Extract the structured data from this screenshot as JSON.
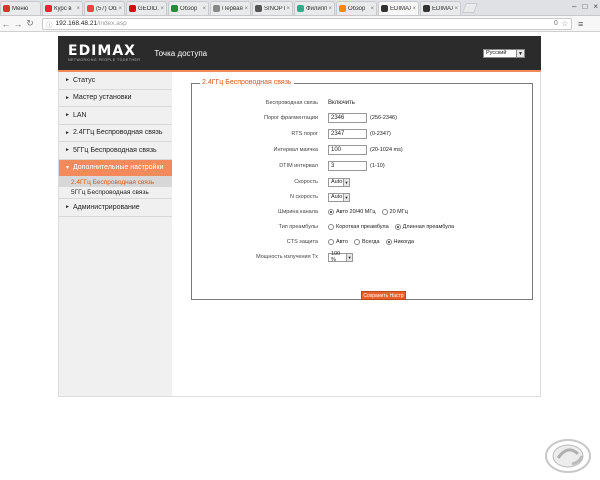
{
  "browser": {
    "tabs": [
      {
        "label": "Меню",
        "color": "#d33"
      },
      {
        "label": "Курс в",
        "color": "#e23"
      },
      {
        "label": "(57) Обз",
        "color": "#e44"
      },
      {
        "label": "GEOID.и",
        "color": "#c11"
      },
      {
        "label": "Обзор",
        "color": "#2a8a3b"
      },
      {
        "label": "Первая",
        "color": "#888"
      },
      {
        "label": "SINOPT",
        "color": "#555"
      },
      {
        "label": "Филипп",
        "color": "#3a8"
      },
      {
        "label": "Обзор",
        "color": "#f80"
      },
      {
        "label": "EDIMAX",
        "color": "#333"
      },
      {
        "label": "EDIMAX",
        "color": "#333"
      }
    ],
    "url_host": "192.168.48.21",
    "url_path": "/index.asp",
    "zoom_badge": "0"
  },
  "header": {
    "logo": "EDIMAX",
    "logo_sub": "NETWORKING PEOPLE TOGETHER",
    "title": "Точка доступа",
    "language": "Русский"
  },
  "sidebar": {
    "items": [
      {
        "label": "Статус"
      },
      {
        "label": "Мастер установки"
      },
      {
        "label": "LAN"
      },
      {
        "label": "2.4ГГц Беспроводная связь"
      },
      {
        "label": "5ГГц Беспроводная связь"
      },
      {
        "label": "Дополнительные настройки"
      },
      {
        "label": "Администрирование"
      }
    ],
    "subitems": [
      {
        "label": "2.4ГГц Беспроводная связь"
      },
      {
        "label": "5ГГц Беспроводная связь"
      }
    ]
  },
  "form": {
    "legend": "2.4ГГц Беспроводная связь",
    "wireless_label": "Беспроводная связь",
    "wireless_value": "Включить",
    "frag_label": "Порог фрагментации",
    "frag_value": "2346",
    "frag_hint": "(256-2346)",
    "rts_label": "RTS порог",
    "rts_value": "2347",
    "rts_hint": "(0-2347)",
    "beacon_label": "Интервал маячка",
    "beacon_value": "100",
    "beacon_hint": "(20-1024 ms)",
    "dtim_label": "DTIM интервал",
    "dtim_value": "3",
    "dtim_hint": "(1-10)",
    "speed_label": "Скорость",
    "speed_value": "Auto",
    "nspeed_label": "N скорость",
    "nspeed_value": "Auto",
    "width_label": "Ширина канала",
    "width_opt1": "Авто 20/40 МГц",
    "width_opt2": "20 МГц",
    "preamble_label": "Тип преамбулы",
    "preamble_opt1": "Короткая преамбула",
    "preamble_opt2": "Длинная преамбула",
    "cts_label": "CTS защита",
    "cts_opt1": "Авто",
    "cts_opt2": "Всегда",
    "cts_opt3": "Никогда",
    "tx_label": "Мощность излучения Тх",
    "tx_value": "100 %",
    "save_label": "Сохранить Настр"
  }
}
